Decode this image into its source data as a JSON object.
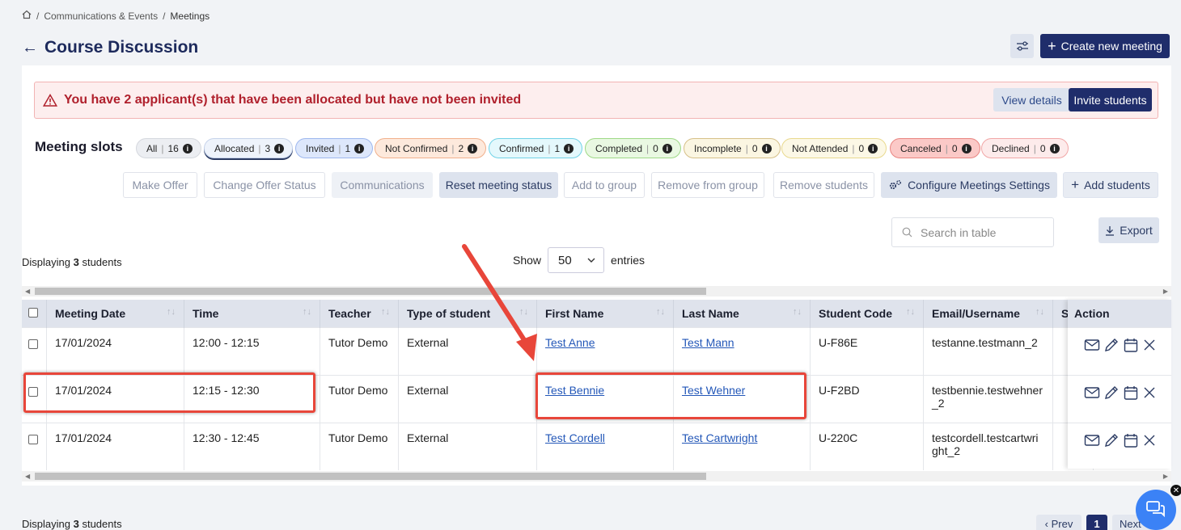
{
  "breadcrumb": {
    "sep": "/",
    "section": "Communications & Events",
    "current": "Meetings"
  },
  "header": {
    "back": "←",
    "title": "Course Discussion",
    "create_label": "Create new meeting",
    "create_plus": "+"
  },
  "alert": {
    "message": "You have 2 applicant(s) that have been allocated but have not been invited",
    "view_details": "View details",
    "invite_students": "Invite students"
  },
  "slots": {
    "label": "Meeting slots",
    "chips": [
      {
        "label": "All",
        "count": "16"
      },
      {
        "label": "Allocated",
        "count": "3"
      },
      {
        "label": "Invited",
        "count": "1"
      },
      {
        "label": "Not Confirmed",
        "count": "2"
      },
      {
        "label": "Confirmed",
        "count": "1"
      },
      {
        "label": "Completed",
        "count": "0"
      },
      {
        "label": "Incomplete",
        "count": "0"
      },
      {
        "label": "Not Attended",
        "count": "0"
      },
      {
        "label": "Canceled",
        "count": "0"
      },
      {
        "label": "Declined",
        "count": "0"
      }
    ],
    "sep": "|"
  },
  "actions": {
    "make_offer": "Make Offer",
    "change_offer_status": "Change Offer Status",
    "communications": "Communications",
    "reset_meeting_status": "Reset meeting status",
    "add_to_group": "Add to group",
    "remove_from_group": "Remove from group",
    "remove_students": "Remove students",
    "configure": "Configure Meetings Settings",
    "add_students": "Add students",
    "add_plus": "+"
  },
  "search": {
    "placeholder": "Search in table"
  },
  "export": {
    "label": "Export"
  },
  "display": {
    "prefix": "Displaying",
    "count": "3",
    "suffix": "students"
  },
  "show": {
    "label": "Show",
    "value": "50",
    "suffix": "entries"
  },
  "table": {
    "headers": [
      "Meeting Date",
      "Time",
      "Teacher",
      "Type of student",
      "First Name",
      "Last Name",
      "Student Code",
      "Email/Username",
      "S"
    ],
    "action_header": "Action",
    "rows": [
      {
        "date": "17/01/2024",
        "time": "12:00 - 12:15",
        "teacher": "Tutor Demo",
        "type": "External",
        "first": "Test Anne",
        "last": "Test Mann",
        "code": "U-F86E",
        "email": "testanne.testmann_2"
      },
      {
        "date": "17/01/2024",
        "time": "12:15 - 12:30",
        "teacher": "Tutor Demo",
        "type": "External",
        "first": "Test Bennie",
        "last": "Test Wehner",
        "code": "U-F2BD",
        "email": "testbennie.testwehner_2"
      },
      {
        "date": "17/01/2024",
        "time": "12:30 - 12:45",
        "teacher": "Tutor Demo",
        "type": "External",
        "first": "Test Cordell",
        "last": "Test Cartwright",
        "code": "U-220C",
        "email": "testcordell.testcartwright_2"
      }
    ]
  },
  "pager": {
    "prev": "‹ Prev",
    "page": "1",
    "next": "Next"
  },
  "colors": {
    "primary": "#1f2d6b",
    "alert_text": "#b0202c",
    "highlight": "#e8463a",
    "link": "#2357b8"
  }
}
